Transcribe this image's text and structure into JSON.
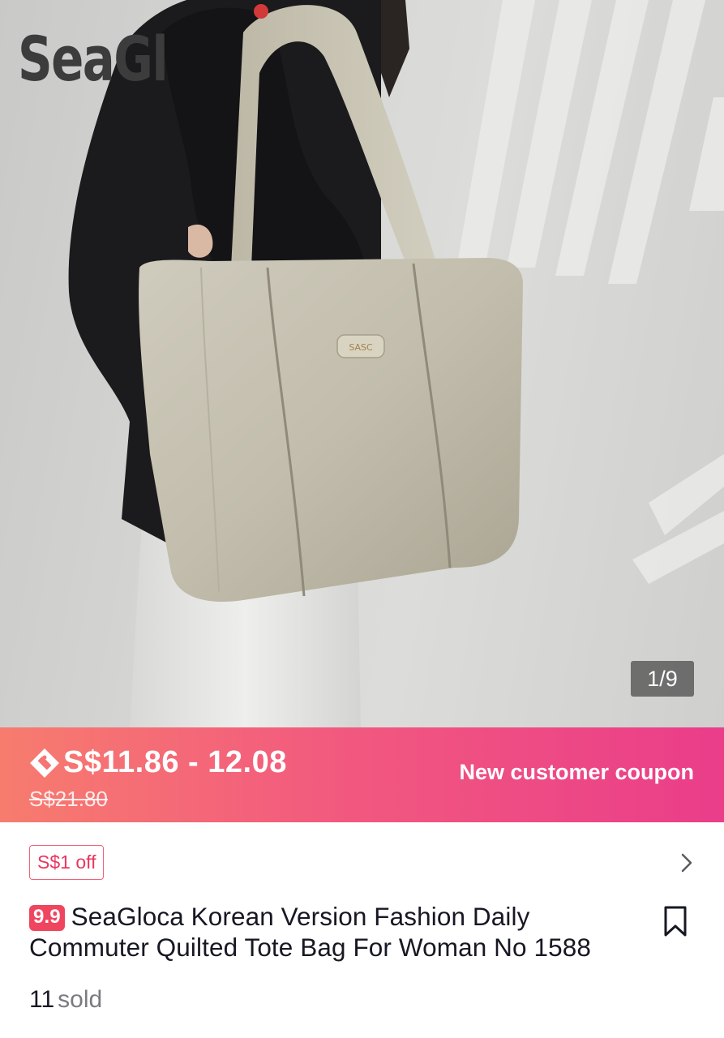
{
  "gallery": {
    "watermark": "SeaGl",
    "counter": "1/9",
    "bag_logo": "SASC"
  },
  "price_banner": {
    "price": "S$11.86 - 12.08",
    "original_price": "S$21.80",
    "coupon_label": "New customer coupon",
    "icon": "coupon-tag-icon"
  },
  "coupon": {
    "chip": "S$1 off",
    "icon": "chevron-right-icon"
  },
  "product": {
    "badge": "9.9",
    "title": "SeaGloca Korean Version Fashion Daily Commuter Quilted Tote Bag For Woman No 1588",
    "bookmark_icon": "bookmark-icon"
  },
  "sales": {
    "count": "11",
    "label": "sold"
  },
  "colors": {
    "banner_start": "#f77c6e",
    "banner_end": "#ea3d8a",
    "accent_pink": "#f0455f",
    "text_primary": "#161823",
    "text_secondary": "#7a7b80"
  }
}
